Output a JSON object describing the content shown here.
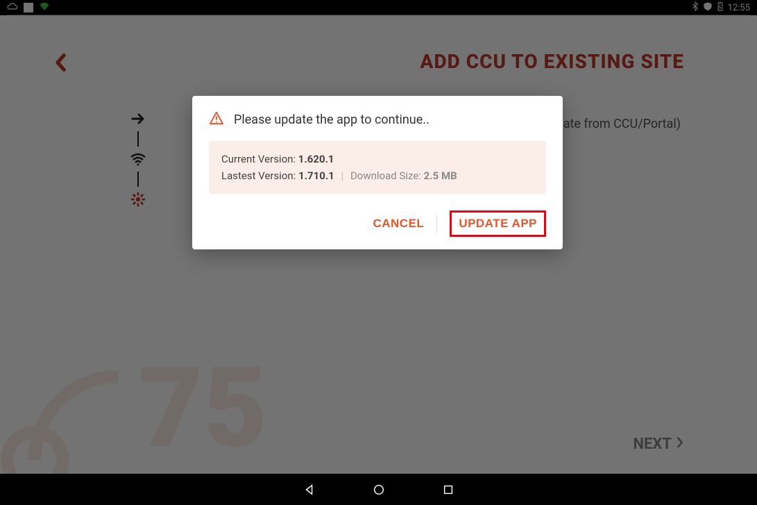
{
  "statusbar": {
    "time": "12:55",
    "icons": {
      "cloud": "cloud-icon",
      "square": "square-icon",
      "wifi_signal": "wifi-icon",
      "bluetooth": "bluetooth-icon",
      "shield": "shield-icon",
      "battery": "battery-icon"
    }
  },
  "page": {
    "title": "ADD CCU TO EXISTING SITE",
    "subtitle_fragment": "ate from CCU/Portal)",
    "next_label": "NEXT"
  },
  "wizard": {
    "step1": "arrow-icon",
    "step2": "wifi-icon",
    "step3": "gear-icon"
  },
  "modal": {
    "title": "Please update the app to continue..",
    "current_label": "Current Version:",
    "current_value": "1.620.1",
    "latest_label": "Lastest Version:",
    "latest_value": "1.710.1",
    "download_label": "Download Size:",
    "download_value": "2.5 MB",
    "cancel_label": "CANCEL",
    "update_label": "UPDATE APP"
  },
  "navbar": {
    "back": "back-icon",
    "home": "home-icon",
    "recent": "recent-icon"
  },
  "colors": {
    "accent": "#e4572e",
    "brand_red": "#c0392b",
    "highlight_border": "#e30613"
  }
}
